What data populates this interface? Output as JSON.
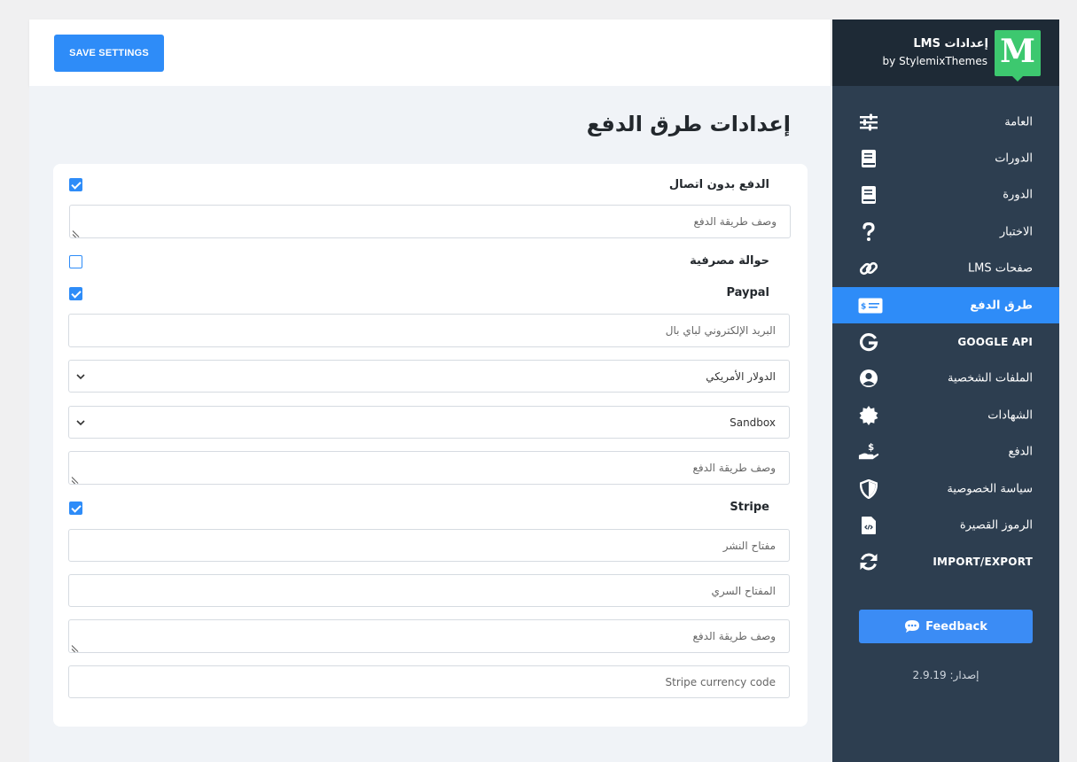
{
  "brand": {
    "logo_letter": "M",
    "title": "إعدادات LMS",
    "subtitle": "by StylemixThemes"
  },
  "toolbar": {
    "save_label": "SAVE SETTINGS"
  },
  "page_title": "إعدادات طرق الدفع",
  "sidebar": {
    "items": [
      {
        "label": "العامة",
        "icon": "sliders-icon"
      },
      {
        "label": "الدورات",
        "icon": "book-icon"
      },
      {
        "label": "الدورة",
        "icon": "book-icon"
      },
      {
        "label": "الاختبار",
        "icon": "question-icon"
      },
      {
        "label": "صفحات LMS",
        "icon": "link-icon"
      },
      {
        "label": "طرق الدفع",
        "icon": "money-check-icon",
        "active": true
      },
      {
        "label": "GOOGLE API",
        "icon": "google-icon"
      },
      {
        "label": "الملفات الشخصية",
        "icon": "user-circle-icon"
      },
      {
        "label": "الشهادات",
        "icon": "certificate-icon"
      },
      {
        "label": "الدفع",
        "icon": "hand-dollar-icon"
      },
      {
        "label": "سياسة الخصوصية",
        "icon": "shield-icon"
      },
      {
        "label": "الرموز القصيرة",
        "icon": "file-code-icon"
      },
      {
        "label": "IMPORT/EXPORT",
        "icon": "sync-icon"
      }
    ],
    "feedback_label": "Feedback",
    "version": "إصدار: 2.9.19"
  },
  "form": {
    "offline": {
      "label": "الدفع بدون اتصال",
      "checked": true,
      "description_placeholder": "وصف طريقة الدفع"
    },
    "bank": {
      "label": "حوالة مصرفية",
      "checked": false
    },
    "paypal": {
      "label": "Paypal",
      "checked": true,
      "email_placeholder": "البريد الإلكتروني لباي بال",
      "currency_value": "الدولار الأمريكي",
      "mode_value": "Sandbox",
      "description_placeholder": "وصف طريقة الدفع"
    },
    "stripe": {
      "label": "Stripe",
      "checked": true,
      "publish_key_placeholder": "مفتاح النشر",
      "secret_key_placeholder": "المفتاح السري",
      "description_placeholder": "وصف طريقة الدفع",
      "currency_placeholder": "Stripe currency code"
    }
  },
  "colors": {
    "accent": "#2e8cf8",
    "sidebar_bg": "#2d3e50",
    "sidebar_head": "#1e2a36",
    "logo_green": "#3dc86f"
  }
}
